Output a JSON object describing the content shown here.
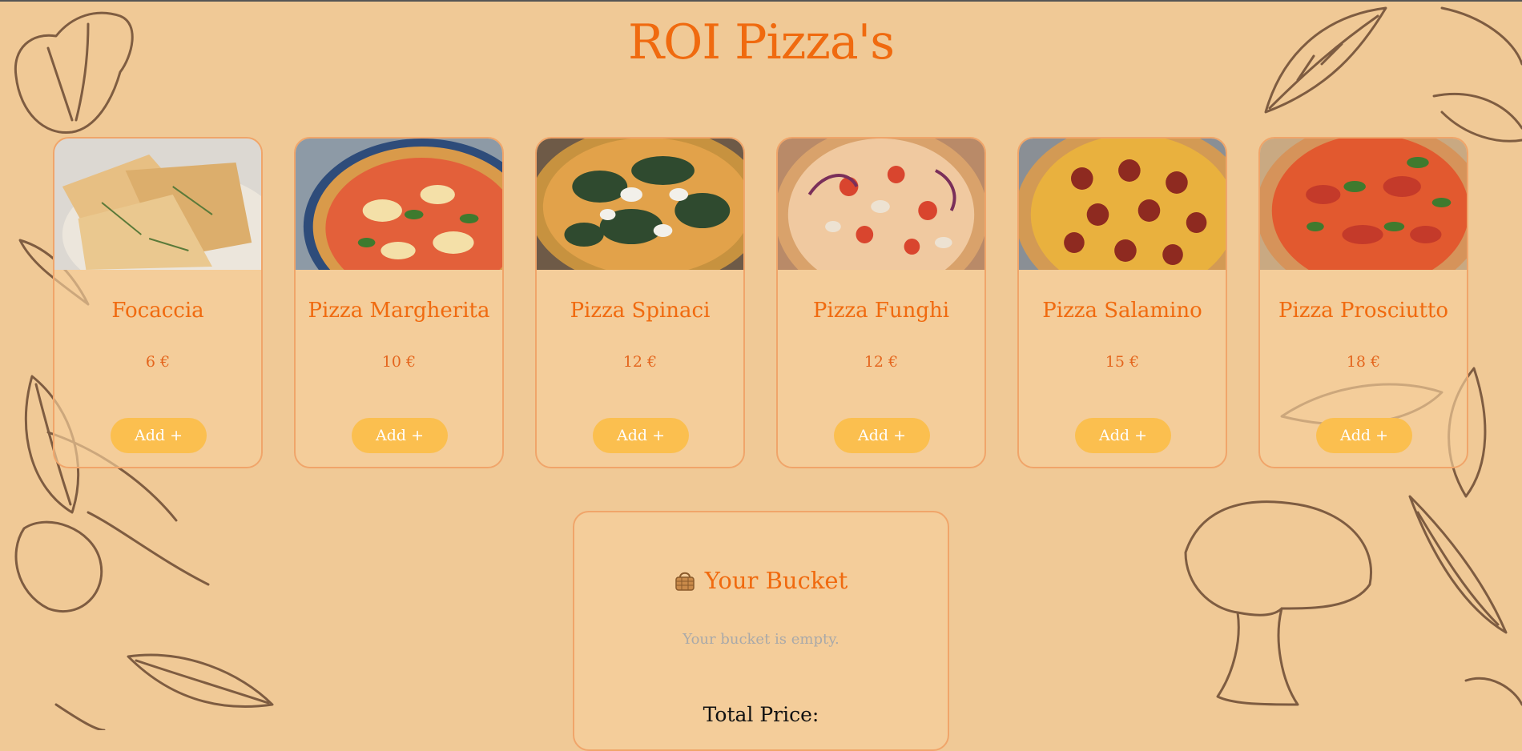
{
  "page": {
    "title": "ROI Pizza's"
  },
  "products": [
    {
      "name": "Focaccia",
      "price": "6 €",
      "add_label": "Add +"
    },
    {
      "name": "Pizza Margherita",
      "price": "10 €",
      "add_label": "Add +"
    },
    {
      "name": "Pizza Spinaci",
      "price": "12 €",
      "add_label": "Add +"
    },
    {
      "name": "Pizza Funghi",
      "price": "12 €",
      "add_label": "Add +"
    },
    {
      "name": "Pizza Salamino",
      "price": "15 €",
      "add_label": "Add +"
    },
    {
      "name": "Pizza Prosciutto",
      "price": "18 €",
      "add_label": "Add +"
    }
  ],
  "bucket": {
    "title": "Your Bucket",
    "icon": "basket-icon",
    "empty_text": "Your bucket is empty.",
    "total_label": "Total Price:"
  },
  "colors": {
    "background": "#f0c996",
    "accent": "#f06a0f",
    "button": "#fbbf4f",
    "card_border": "#f0a56a",
    "sketch": "#6b4a33"
  }
}
